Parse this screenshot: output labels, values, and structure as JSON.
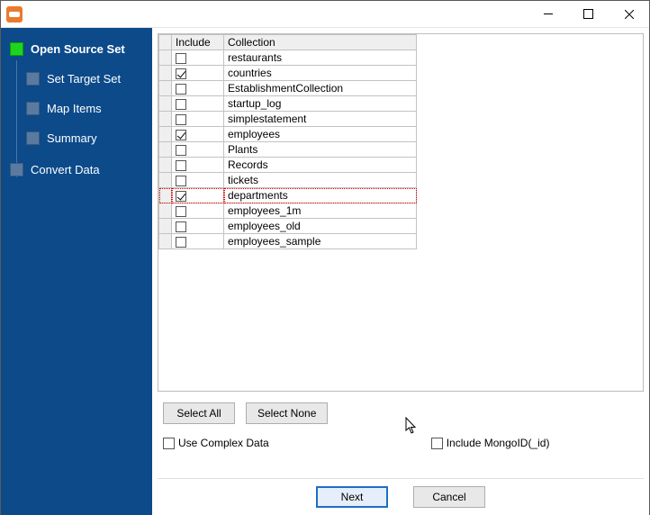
{
  "sidebar": {
    "steps": [
      {
        "label": "Open Source Set",
        "active": true,
        "child": false
      },
      {
        "label": "Set Target Set",
        "active": false,
        "child": true
      },
      {
        "label": "Map Items",
        "active": false,
        "child": true
      },
      {
        "label": "Summary",
        "active": false,
        "child": true
      },
      {
        "label": "Convert Data",
        "active": false,
        "child": false
      }
    ]
  },
  "table": {
    "headers": {
      "include": "Include",
      "collection": "Collection"
    },
    "rows": [
      {
        "include": false,
        "name": "restaurants",
        "hot": false
      },
      {
        "include": true,
        "name": "countries",
        "hot": false
      },
      {
        "include": false,
        "name": "EstablishmentCollection",
        "hot": false
      },
      {
        "include": false,
        "name": "startup_log",
        "hot": false
      },
      {
        "include": false,
        "name": "simplestatement",
        "hot": false
      },
      {
        "include": true,
        "name": "employees",
        "hot": false
      },
      {
        "include": false,
        "name": "Plants",
        "hot": false
      },
      {
        "include": false,
        "name": "Records",
        "hot": false
      },
      {
        "include": false,
        "name": "tickets",
        "hot": false
      },
      {
        "include": true,
        "name": "departments",
        "hot": true
      },
      {
        "include": false,
        "name": "employees_1m",
        "hot": false
      },
      {
        "include": false,
        "name": "employees_old",
        "hot": false
      },
      {
        "include": false,
        "name": "employees_sample",
        "hot": false
      }
    ]
  },
  "buttons": {
    "select_all": "Select All",
    "select_none": "Select None",
    "next": "Next",
    "cancel": "Cancel"
  },
  "options": {
    "use_complex_data": {
      "label": "Use Complex Data",
      "checked": false
    },
    "include_mongo_id": {
      "label": "Include MongoID(_id)",
      "checked": false
    }
  }
}
